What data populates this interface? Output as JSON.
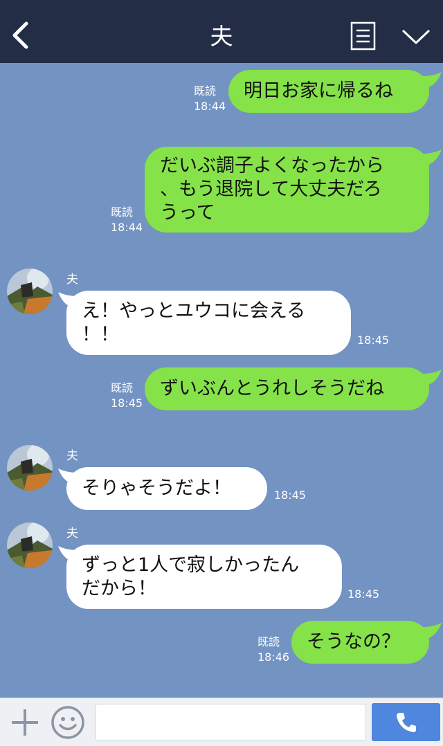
{
  "header": {
    "title": "夫",
    "icons": [
      "back-icon",
      "menu-icon",
      "chevron-down-icon"
    ]
  },
  "messages": [
    {
      "side": "mine",
      "text": "明日お家に帰るね",
      "read": "既読",
      "time": "18:44"
    },
    {
      "side": "mine",
      "text": "だいぶ調子よくなったから\n、もう退院して大丈夫だろ\nうって",
      "read": "既読",
      "time": "18:44"
    },
    {
      "side": "theirs",
      "sender": "夫",
      "text": "え！やっとユウコに会える\n！！",
      "time": "18:45"
    },
    {
      "side": "mine",
      "text": "ずいぶんとうれしそうだね",
      "read": "既読",
      "time": "18:45"
    },
    {
      "side": "theirs",
      "sender": "夫",
      "text": "そりゃそうだよ！",
      "time": "18:45"
    },
    {
      "side": "theirs",
      "sender": "夫",
      "text": "ずっと1人で寂しかったん\nだから！",
      "time": "18:45"
    },
    {
      "side": "mine",
      "text": "そうなの？",
      "read": "既読",
      "time": "18:46"
    }
  ],
  "input_bar": {
    "placeholder": "",
    "icons": [
      "plus-icon",
      "emoji-icon",
      "phone-icon"
    ]
  },
  "colors": {
    "header_bg": "#232d46",
    "chat_bg": "#7393c2",
    "my_bubble": "#85e249",
    "their_bubble": "#ffffff",
    "call_button": "#4f86de"
  }
}
